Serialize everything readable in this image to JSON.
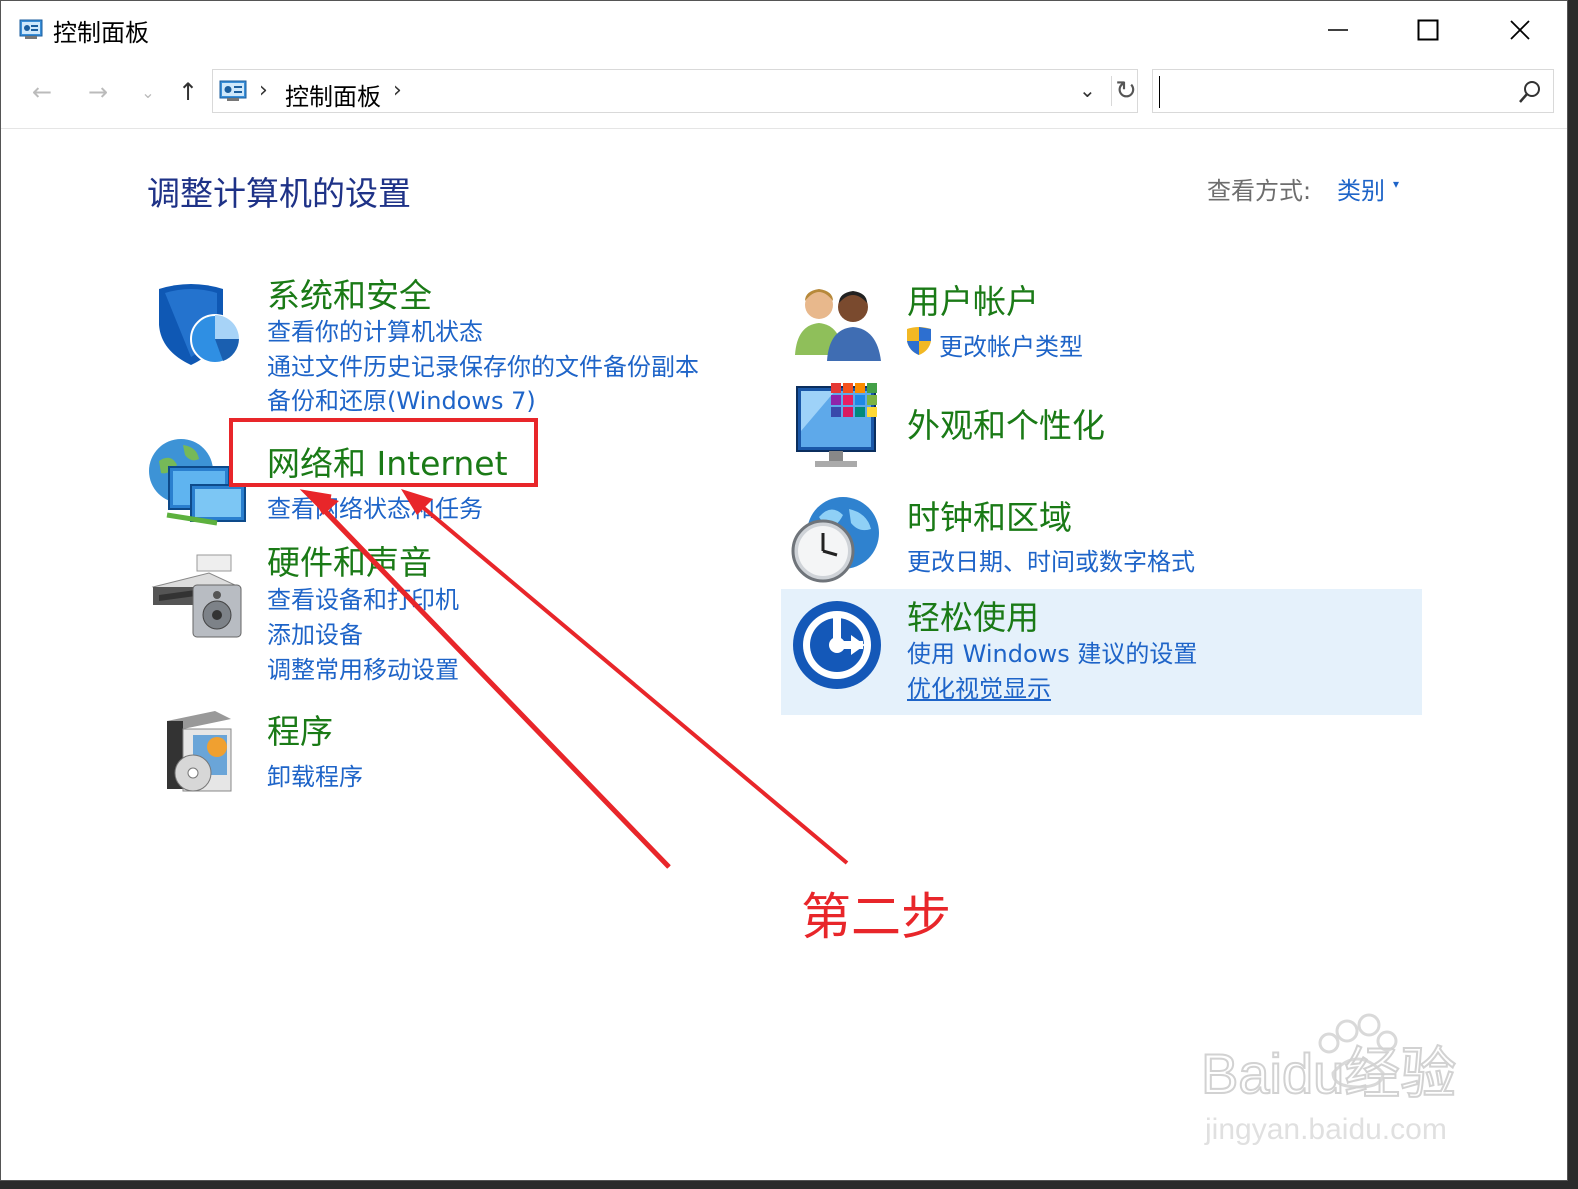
{
  "window": {
    "title": "控制面板"
  },
  "address": {
    "crumb": "控制面板",
    "search_placeholder": ""
  },
  "content": {
    "heading": "调整计算机的设置",
    "view_label": "查看方式:",
    "view_value": "类别"
  },
  "categories": {
    "system": {
      "title": "系统和安全",
      "links": [
        "查看你的计算机状态",
        "通过文件历史记录保存你的文件备份副本",
        "备份和还原(Windows 7)"
      ]
    },
    "network": {
      "title": "网络和 Internet",
      "links": [
        "查看网络状态和任务"
      ]
    },
    "hardware": {
      "title": "硬件和声音",
      "links": [
        "查看设备和打印机",
        "添加设备",
        "调整常用移动设置"
      ]
    },
    "programs": {
      "title": "程序",
      "links": [
        "卸载程序"
      ]
    },
    "users": {
      "title": "用户帐户",
      "links": [
        "更改帐户类型"
      ]
    },
    "appearance": {
      "title": "外观和个性化",
      "links": []
    },
    "clock": {
      "title": "时钟和区域",
      "links": [
        "更改日期、时间或数字格式"
      ]
    },
    "ease": {
      "title": "轻松使用",
      "links": [
        "使用 Windows 建议的设置",
        "优化视觉显示"
      ]
    }
  },
  "annotation": {
    "text": "第二步",
    "color": "#e8262a"
  },
  "watermark": {
    "brand": "Baidu经验",
    "url": "jingyan.baidu.com"
  },
  "colors": {
    "category_title": "#1a7a16",
    "link": "#1e64c8",
    "heading": "#1e3287",
    "highlight": "#e5f1fb"
  }
}
